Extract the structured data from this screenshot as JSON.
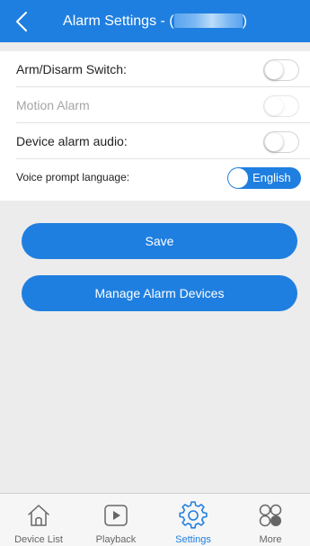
{
  "colors": {
    "accent": "#1f7fe0",
    "background": "#ececec",
    "panel": "#ffffff",
    "text_primary": "#222222",
    "text_disabled": "#a5a5a5",
    "tab_inactive": "#666666"
  },
  "header": {
    "back_icon": "chevron-left-icon",
    "title": "Alarm Settings  - (",
    "title_suffix": ")"
  },
  "settings": {
    "arm_disarm": {
      "label": "Arm/Disarm Switch:",
      "enabled": false
    },
    "motion_alarm": {
      "label": "Motion Alarm",
      "enabled": false,
      "disabled": true
    },
    "device_audio": {
      "label": "Device alarm audio:",
      "enabled": false
    },
    "voice_language": {
      "label": "Voice prompt language:",
      "value": "English"
    }
  },
  "buttons": {
    "save": "Save",
    "manage": "Manage Alarm Devices"
  },
  "tabbar": {
    "items": [
      {
        "label": "Device List",
        "icon": "home-icon",
        "active": false
      },
      {
        "label": "Playback",
        "icon": "play-icon",
        "active": false
      },
      {
        "label": "Settings",
        "icon": "gear-icon",
        "active": true
      },
      {
        "label": "More",
        "icon": "more-icon",
        "active": false
      }
    ]
  }
}
